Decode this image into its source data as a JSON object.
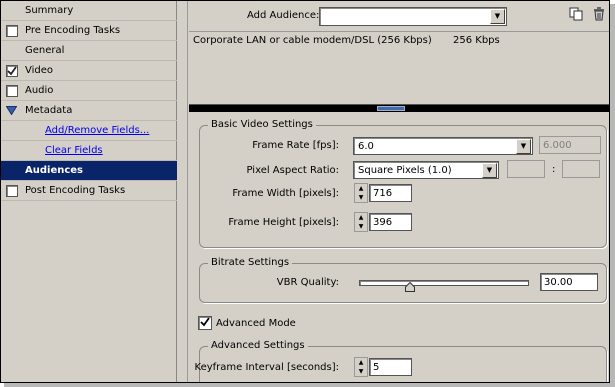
{
  "nav": {
    "items": [
      {
        "label": "Summary",
        "checkbox": false
      },
      {
        "label": "Pre Encoding Tasks",
        "checkbox": true,
        "checked": false
      },
      {
        "label": "General",
        "checkbox": false
      },
      {
        "label": "Video",
        "checkbox": true,
        "checked": true
      },
      {
        "label": "Audio",
        "checkbox": true,
        "checked": false
      },
      {
        "label": "Metadata",
        "expanded": true
      },
      {
        "label": "Add/Remove Fields...",
        "link": true
      },
      {
        "label": "Clear Fields",
        "link": true
      },
      {
        "label": "Audiences",
        "selected": true
      },
      {
        "label": "Post Encoding Tasks",
        "checkbox": true,
        "checked": false
      }
    ]
  },
  "audience": {
    "add_label": "Add Audience:",
    "add_value": "",
    "rows": [
      {
        "name": "Corporate LAN or cable modem/DSL (256 Kbps)",
        "bitrate": "256 Kbps"
      }
    ]
  },
  "basic_video": {
    "title": "Basic Video Settings",
    "frame_rate_label": "Frame Rate [fps]:",
    "frame_rate_value": "6.0",
    "frame_rate_custom": "6.000",
    "pixel_aspect_label": "Pixel Aspect Ratio:",
    "pixel_aspect_value": "Square Pixels (1.0)",
    "aspect_separator": ":",
    "frame_width_label": "Frame Width [pixels]:",
    "frame_width_value": "716",
    "frame_height_label": "Frame Height [pixels]:",
    "frame_height_value": "396"
  },
  "bitrate": {
    "title": "Bitrate Settings",
    "vbr_label": "VBR Quality:",
    "vbr_value": "30.00",
    "vbr_fraction": 0.3
  },
  "advanced_mode": {
    "label": "Advanced Mode",
    "checked": true
  },
  "advanced": {
    "title": "Advanced Settings",
    "keyframe_label": "Keyframe Interval [seconds]:",
    "keyframe_value": "5"
  },
  "icons": {
    "copy": "copy-icon",
    "delete": "trash-icon",
    "dropdown": "chevron-down-icon"
  },
  "colors": {
    "selection": "#0a246a",
    "panel": "#d4d0c8",
    "link": "#0000ee"
  }
}
